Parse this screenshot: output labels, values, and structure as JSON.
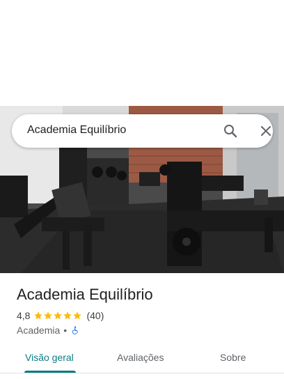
{
  "search": {
    "query": "Academia Equilíbrio",
    "search_icon": "search-icon",
    "close_icon": "close-icon"
  },
  "photo": {
    "description_icon": "gym-photo"
  },
  "place": {
    "name": "Academia Equilíbrio",
    "rating": "4,8",
    "stars_filled": 5,
    "reviews": "(40)",
    "category": "Academia",
    "separator": "•",
    "accessibility_icon": "wheelchair-accessible-icon"
  },
  "tabs": [
    {
      "label": "Visão geral",
      "active": true
    },
    {
      "label": "Avaliações",
      "active": false
    },
    {
      "label": "Sobre",
      "active": false
    }
  ],
  "colors": {
    "accent": "#0a7b83",
    "star": "#fbbc04",
    "accessibility": "#1a73e8"
  }
}
